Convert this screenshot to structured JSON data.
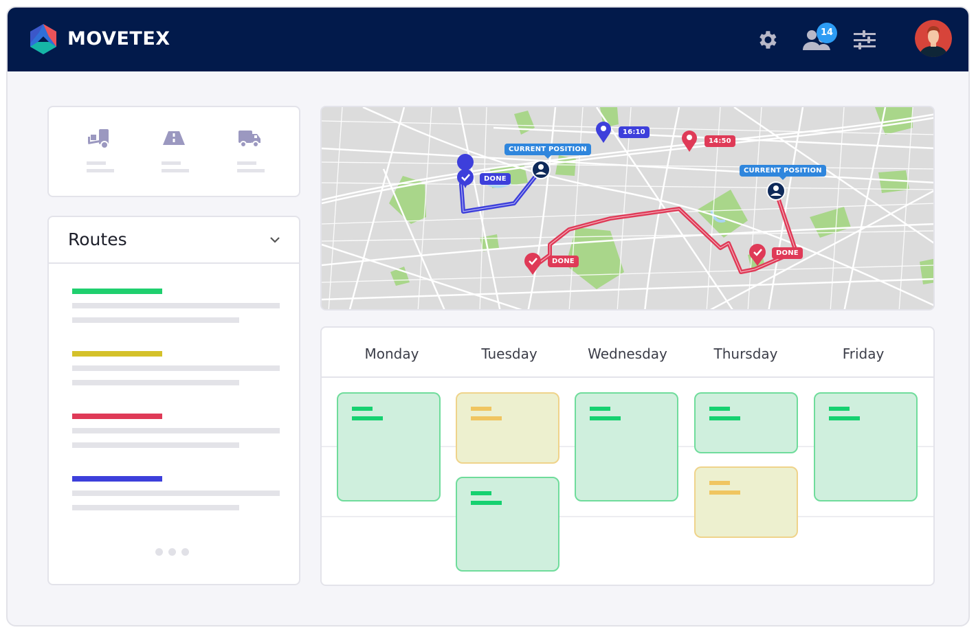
{
  "app": {
    "brand": "MOVETEX",
    "accent_color": "#021a4b"
  },
  "header": {
    "icons": [
      "gear-icon",
      "users-icon",
      "sliders-icon"
    ],
    "notification_count": "14",
    "badge_color": "#2d9cf4",
    "avatar": "user-avatar"
  },
  "stats": {
    "items": [
      {
        "icon": "forklift-icon"
      },
      {
        "icon": "road-icon"
      },
      {
        "icon": "truck-icon"
      }
    ]
  },
  "routes": {
    "title": "Routes",
    "items": [
      {
        "color": "#1fcf6e"
      },
      {
        "color": "#d4c12a"
      },
      {
        "color": "#df3a57"
      },
      {
        "color": "#3d3fdb"
      }
    ],
    "more": "..."
  },
  "map": {
    "labels": {
      "current_position_1": "CURRENT POSITION",
      "current_position_2": "CURRENT POSITION",
      "done_blue": "DONE",
      "done_red_1": "DONE",
      "done_red_2": "DONE",
      "time_blue": "16:10",
      "time_red": "14:50"
    },
    "route_colors": {
      "blue": "#3d3fdb",
      "red": "#df3a57"
    }
  },
  "calendar": {
    "days": [
      "Monday",
      "Tuesday",
      "Wednesday",
      "Thursday",
      "Friday"
    ],
    "events": [
      {
        "day": "Monday",
        "status": "green"
      },
      {
        "day": "Tuesday",
        "status": "yellow"
      },
      {
        "day": "Tuesday",
        "status": "green"
      },
      {
        "day": "Wednesday",
        "status": "green"
      },
      {
        "day": "Thursday",
        "status": "green"
      },
      {
        "day": "Thursday",
        "status": "yellow"
      },
      {
        "day": "Friday",
        "status": "green"
      }
    ]
  }
}
